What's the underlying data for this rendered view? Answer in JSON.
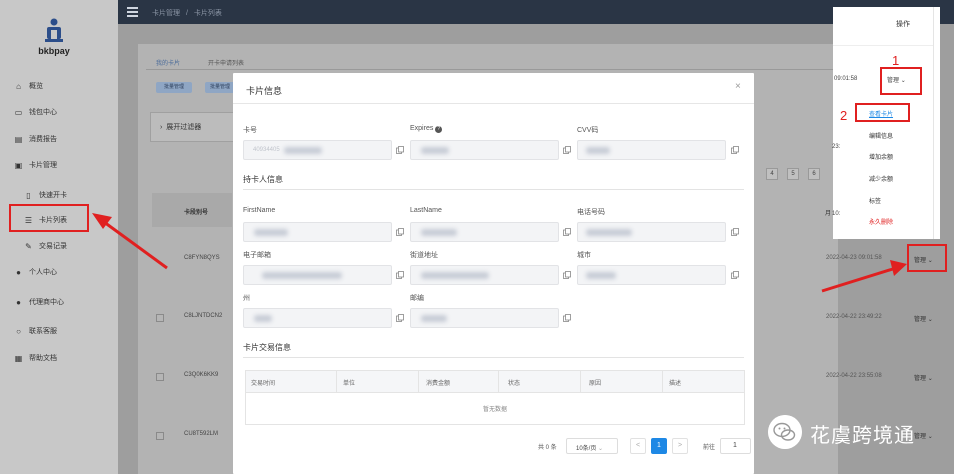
{
  "app": {
    "name": "bkbpay"
  },
  "header": {
    "breadcrumb": [
      "卡片管理",
      "卡片列表"
    ],
    "separator": "/"
  },
  "sidebar": {
    "items": [
      {
        "label": "概览",
        "icon": "home-icon"
      },
      {
        "label": "钱包中心",
        "icon": "wallet-icon"
      },
      {
        "label": "消费报告",
        "icon": "report-icon"
      },
      {
        "label": "卡片管理",
        "icon": "card-icon"
      },
      {
        "label": "快速开卡",
        "icon": "document-icon"
      },
      {
        "label": "卡片列表",
        "icon": "list-icon"
      },
      {
        "label": "交易记录",
        "icon": "edit-icon"
      },
      {
        "label": "个人中心",
        "icon": "user-icon"
      },
      {
        "label": "代理商中心",
        "icon": "agent-icon"
      },
      {
        "label": "联系客服",
        "icon": "chat-icon"
      },
      {
        "label": "帮助文档",
        "icon": "help-icon"
      }
    ]
  },
  "background": {
    "tabs": [
      "我的卡片",
      "开卡申请列表"
    ],
    "buttons": [
      "批量管理",
      "批量管理"
    ],
    "filter_label": "展开过滤器",
    "column_header": "卡段别号",
    "rows": [
      {
        "id": "C8FYN8QYS",
        "date": "2022-04-23 09:01:58",
        "action": "管理"
      },
      {
        "id": "C8LJNTDCN2",
        "date": "2022-04-22 23:49:22",
        "action": "管理"
      },
      {
        "id": "C3Q0K6KK9",
        "date": "2022-04-22 23:55:08",
        "action": "管理"
      },
      {
        "id": "CU8T592LM",
        "date": "",
        "action": "管理"
      }
    ],
    "pager": [
      "4",
      "5",
      "6"
    ]
  },
  "modal": {
    "title": "卡片信息",
    "close": "×",
    "fields": {
      "card_number": {
        "label": "卡号",
        "value": "40934405"
      },
      "expires": {
        "label": "Expires",
        "info_icon": "info-icon"
      },
      "cvv": {
        "label": "CVV码"
      },
      "first_name": {
        "label": "FirstName"
      },
      "last_name": {
        "label": "LastName"
      },
      "phone": {
        "label": "电话号码"
      },
      "email": {
        "label": "电子邮箱"
      },
      "street": {
        "label": "街道地址"
      },
      "city": {
        "label": "城市"
      },
      "state": {
        "label": "州"
      },
      "zip": {
        "label": "邮编"
      }
    },
    "section_holder": "持卡人信息",
    "section_tx": "卡片交易信息",
    "table": {
      "columns": [
        "交易时间",
        "单位",
        "消费金额",
        "状态",
        "原因",
        "描述"
      ],
      "empty": "暂无数据"
    },
    "pagination": {
      "total": "共 0 条",
      "page_size": "10条/页",
      "prev": "<",
      "current": "1",
      "next": ">",
      "goto_label": "前往",
      "goto_value": "1"
    }
  },
  "inset": {
    "header": "操作",
    "time1": "09:01:58",
    "manage": "管理",
    "time2": "23:49:",
    "time3": "10:50:",
    "menu": [
      "查看卡片",
      "编辑信息",
      "增加余额",
      "减少余额",
      "标签",
      "永久删除"
    ]
  },
  "annotations": {
    "step1": "1",
    "step2": "2"
  },
  "colors": {
    "accent": "#1e88e5",
    "danger": "#e02020",
    "topbar": "#2a3545"
  },
  "watermark": {
    "text": "花虞跨境通"
  }
}
